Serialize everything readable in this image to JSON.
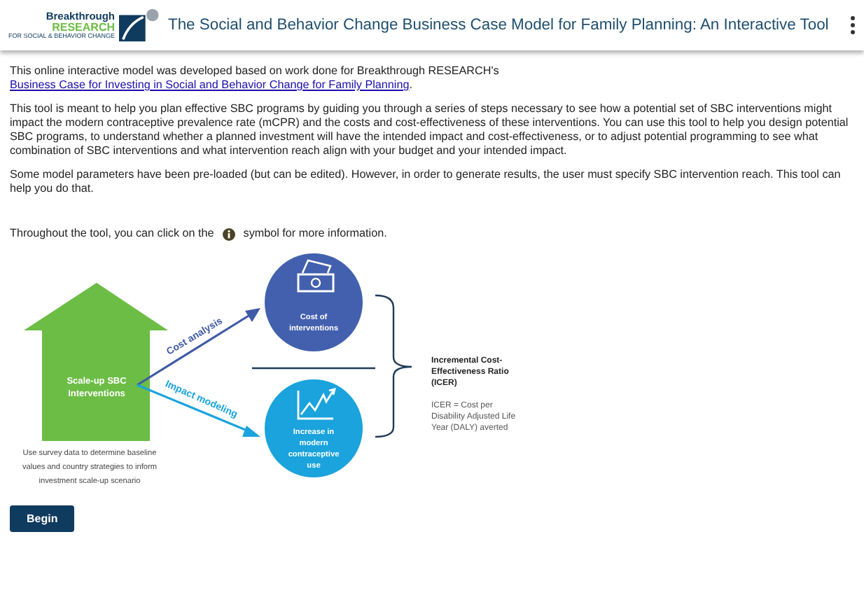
{
  "header": {
    "logo_top": "Breakthrough",
    "logo_main": "RESEARCH",
    "logo_tagline": "FOR SOCIAL & BEHAVIOR CHANGE",
    "title": "The Social and Behavior Change Business Case Model for Family Planning: An Interactive Tool"
  },
  "intro": {
    "before_link": "This online interactive model was developed based on work done for Breakthrough RESEARCH's ",
    "link": "Business Case for Investing in Social and Behavior Change for Family Planning",
    "after_link": "."
  },
  "paragraphs": [
    "This tool is meant to help you plan effective SBC programs by guiding you through a series of steps necessary to see how a potential set of SBC interventions might impact the modern contraceptive prevalence rate (mCPR) and the costs and cost-effectiveness of these interventions. You can use this tool to help you design potential SBC programs, to understand whether a planned investment will have the intended impact and cost-effectiveness, or to adjust potential programming to see what combination of SBC interventions and what intervention reach align with your budget and your intended impact.",
    "Some model parameters have been pre-loaded (but can be edited). However, in order to generate results, the user must specify SBC intervention reach. This tool can help you do that."
  ],
  "info_line": {
    "before": "Throughout the tool, you can click on the",
    "after": "symbol for more information."
  },
  "diagram": {
    "scale_up": [
      "Scale-up SBC",
      "Interventions"
    ],
    "caption": [
      "Use survey data to determine baseline",
      "values and country strategies to inform",
      "investment scale-up scenario"
    ],
    "cost_arrow": "Cost analysis",
    "impact_arrow": "Impact modeling",
    "cost_circle": [
      "Cost of",
      "interventions"
    ],
    "impact_circle": [
      "Increase in",
      "modern",
      "contraceptive",
      "use"
    ],
    "icer_title": [
      "Incremental Cost-",
      "Effectiveness Ratio",
      "(ICER)"
    ],
    "icer_note": [
      "ICER = Cost per",
      "Disability Adjusted Life",
      "Year (DALY) averted"
    ]
  },
  "begin_button": "Begin"
}
